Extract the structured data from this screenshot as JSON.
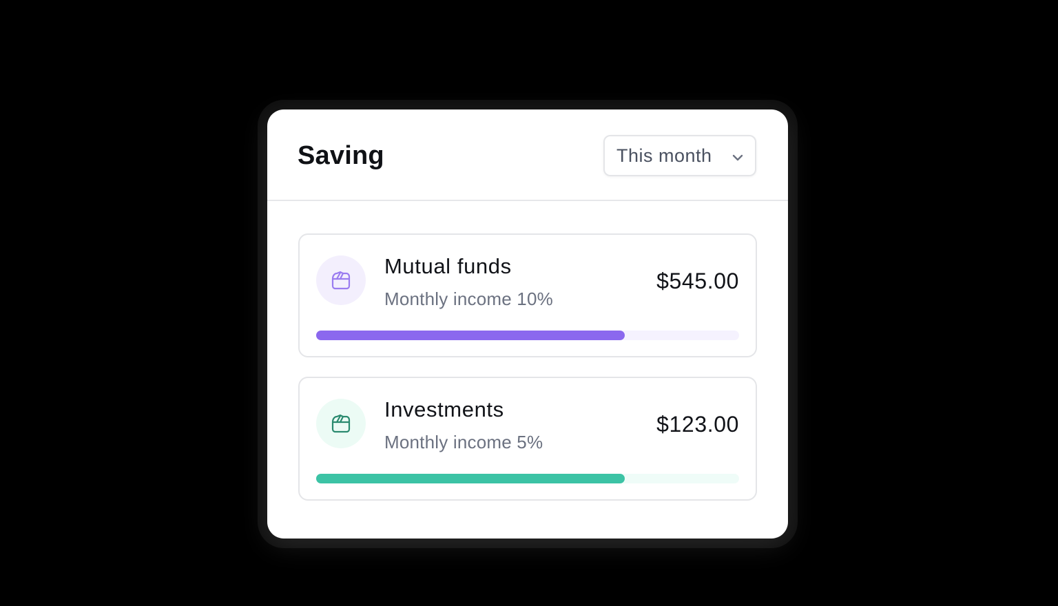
{
  "widget": {
    "title": "Saving",
    "period_select": {
      "selected": "This month",
      "icon": "chevron-down-icon"
    }
  },
  "items": [
    {
      "name": "Mutual funds",
      "subtitle": "Monthly income 10%",
      "amount": "$545.00",
      "icon": "wallet-icon",
      "progress": 0.73,
      "color": "#8b68ee",
      "track_color": "#f5f2fe",
      "icon_bg": "#f3effd"
    },
    {
      "name": "Investments",
      "subtitle": "Monthly income 5%",
      "amount": "$123.00",
      "icon": "wallet-icon",
      "progress": 0.73,
      "color": "#3cc3a5",
      "track_color": "#effcf8",
      "icon_bg": "#ecfbf5",
      "icon_stroke": "#2a8a6f"
    }
  ]
}
